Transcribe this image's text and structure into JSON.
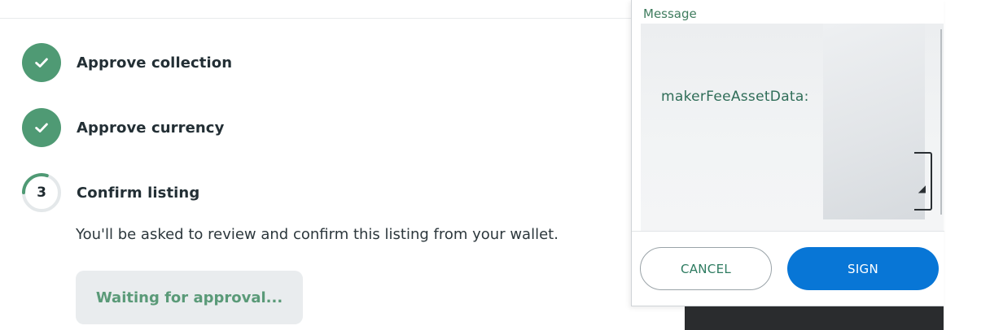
{
  "steps": [
    {
      "status": "done",
      "label": "Approve collection",
      "icon": "check-icon"
    },
    {
      "status": "done",
      "label": "Approve currency",
      "icon": "check-icon"
    },
    {
      "status": "active",
      "number": "3",
      "label": "Confirm listing",
      "progress": 0.3
    }
  ],
  "confirm_description": "You'll be asked to review and confirm this listing from your wallet.",
  "wait_button_label": "Waiting for approval...",
  "wallet": {
    "message_label": "Message",
    "message_key": "makerFeeAssetData:",
    "cancel_label": "CANCEL",
    "sign_label": "SIGN"
  },
  "colors": {
    "success_green": "#4f9a74",
    "primary_blue": "#0876d6",
    "muted_green_text": "#5a9a78"
  }
}
